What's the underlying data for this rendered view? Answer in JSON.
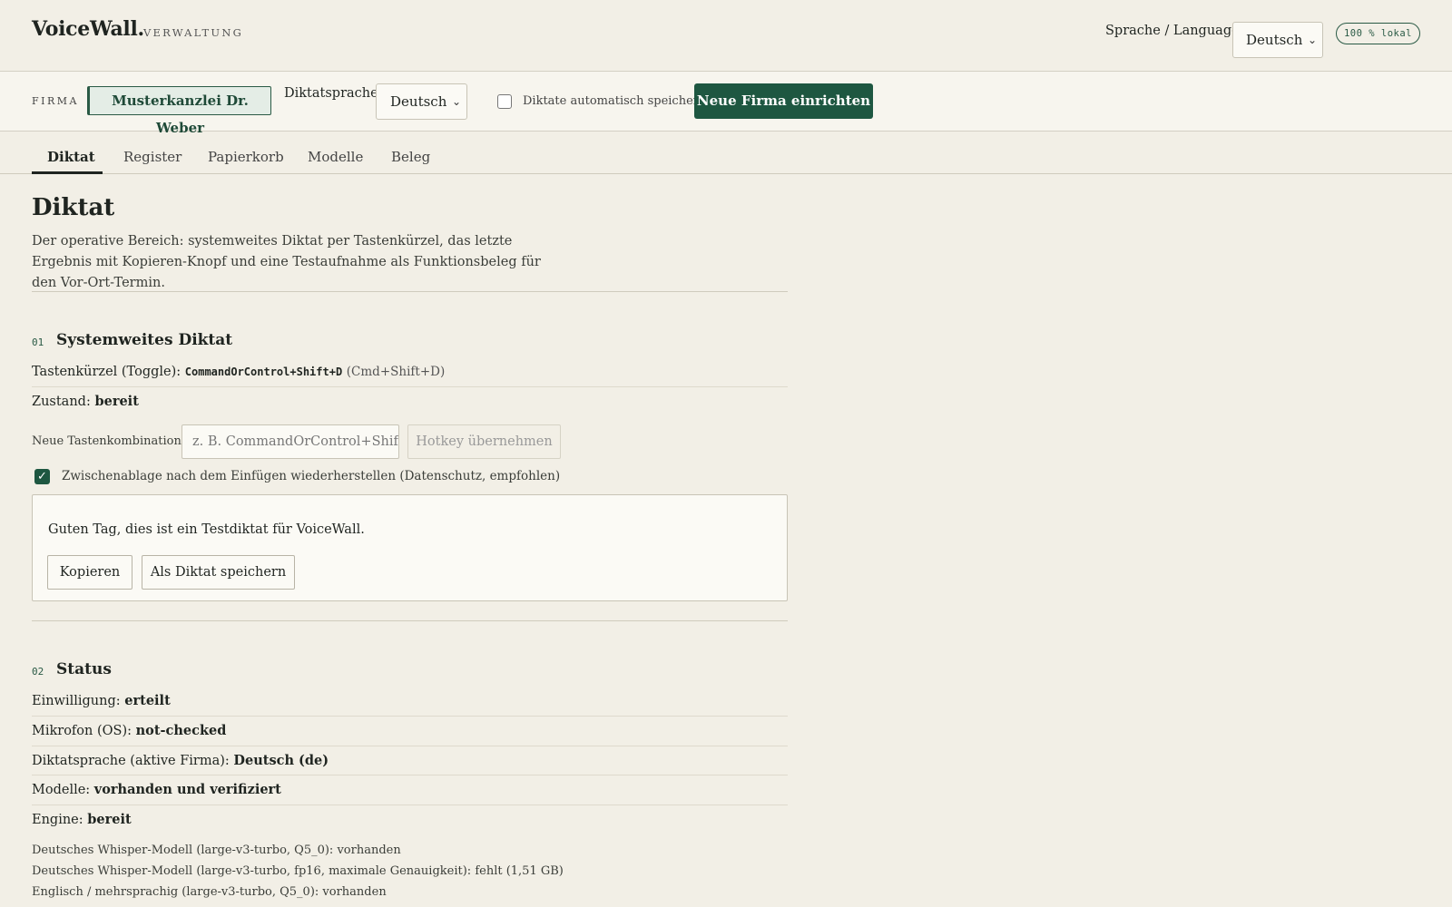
{
  "header": {
    "brand": "VoiceWall.",
    "brand_sub": "VERWALTUNG",
    "language_label": "Sprache / Language",
    "language_value": "Deutsch",
    "local_badge": "100 % lokal"
  },
  "firmbar": {
    "firm_label": "FIRMA",
    "firm_name": "Musterkanzlei Dr. Weber",
    "dictation_language_label": "Diktatsprache",
    "dictation_language_value": "Deutsch",
    "autosave_label": "Diktate automatisch speichern",
    "autosave_checked": false,
    "new_firm_button": "Neue Firma einrichten"
  },
  "tabs": [
    {
      "label": "Diktat",
      "active": true
    },
    {
      "label": "Register",
      "active": false
    },
    {
      "label": "Papierkorb",
      "active": false
    },
    {
      "label": "Modelle",
      "active": false
    },
    {
      "label": "Beleg",
      "active": false
    }
  ],
  "page": {
    "title": "Diktat",
    "description": "Der operative Bereich: systemweites Diktat per Tastenkürzel, das letzte Ergebnis mit Kopieren-Knopf und eine Testaufnahme als Funktionsbeleg für den Vor-Ort-Termin."
  },
  "section1": {
    "number": "01",
    "title": "Systemweites Diktat",
    "hotkey_prefix": "Tastenkürzel (Toggle):",
    "hotkey_value": "CommandOrControl+Shift+D",
    "hotkey_hint": "(Cmd+Shift+D)",
    "state_prefix": "Zustand:",
    "state_value": "bereit",
    "new_hotkey_label": "Neue Tastenkombination:",
    "new_hotkey_placeholder": "z. B. CommandOrControl+Shift+D",
    "apply_hotkey_button": "Hotkey übernehmen",
    "restore_clipboard_label": "Zwischenablage nach dem Einfügen wiederherstellen (Datenschutz, empfohlen)",
    "restore_clipboard_checked": true,
    "result_text": "Guten Tag, dies ist ein Testdiktat für VoiceWall.",
    "copy_button": "Kopieren",
    "save_button": "Als Diktat speichern"
  },
  "section2": {
    "number": "02",
    "title": "Status",
    "rows": [
      {
        "label": "Einwilligung:",
        "value": "erteilt"
      },
      {
        "label": "Mikrofon (OS):",
        "value": "not-checked"
      },
      {
        "label": "Diktatsprache (aktive Firma):",
        "value": "Deutsch (de)"
      },
      {
        "label": "Modelle:",
        "value": "vorhanden und verifiziert"
      },
      {
        "label": "Engine:",
        "value": "bereit"
      }
    ],
    "models": [
      "Deutsches Whisper-Modell (large-v3-turbo, Q5_0): vorhanden",
      "Deutsches Whisper-Modell (large-v3-turbo, fp16, maximale Genauigkeit): fehlt (1,51 GB)",
      "Englisch / mehrsprachig (large-v3-turbo, Q5_0): vorhanden"
    ]
  }
}
